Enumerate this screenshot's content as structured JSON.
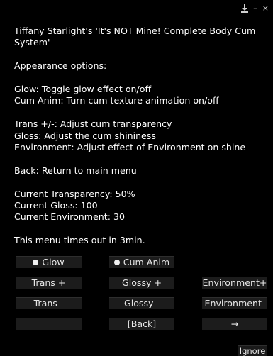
{
  "titlebar": {
    "download_icon": "download-icon",
    "minimize_glyph": "–",
    "close_glyph": "×"
  },
  "message": {
    "lines": [
      "Tiffany Starlight's 'It's NOT Mine! Complete Body Cum",
      "System'",
      "",
      "Appearance options:",
      "",
      "Glow: Toggle glow effect on/off",
      "Cum Anim: Turn cum texture animation on/off",
      "",
      "Trans +/-: Adjust cum transparency",
      "Gloss: Adjust the cum shininess",
      "Environment: Adjust effect of Environment on shine",
      "",
      "Back: Return to main menu",
      "",
      "Current Transparency: 50%",
      "Current Gloss: 100",
      "Current Environment: 30",
      "",
      "This menu times out in 3min."
    ]
  },
  "buttons": {
    "glow": "Glow",
    "cum_anim": "Cum Anim",
    "trans_plus": "Trans +",
    "glossy_plus": "Glossy +",
    "environment_plus": "Environment+",
    "trans_minus": "Trans -",
    "glossy_minus": "Glossy -",
    "environment_minus": "Environment-",
    "empty": "",
    "back": "[Back]",
    "next": "→",
    "ignore": "Ignore"
  }
}
